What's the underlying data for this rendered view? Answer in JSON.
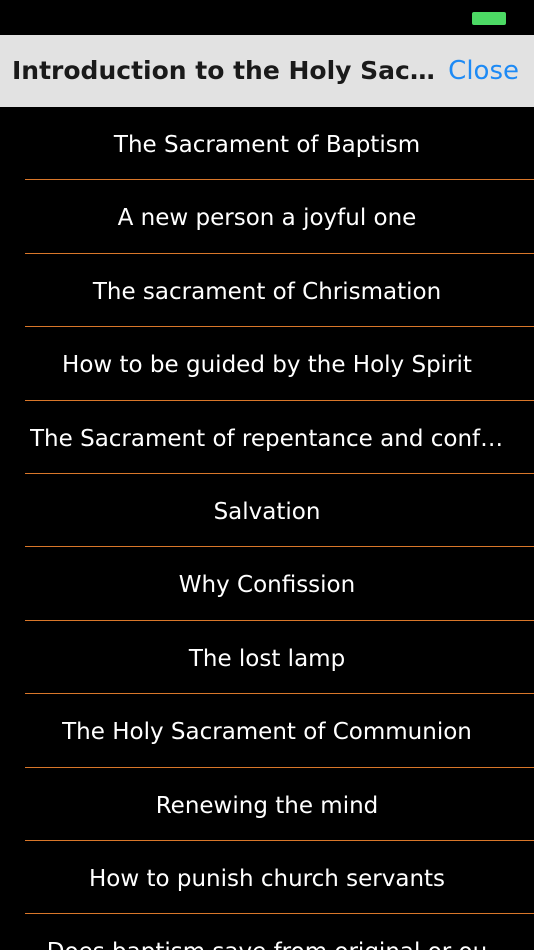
{
  "status_bar": {
    "battery_color": "#4cd964"
  },
  "nav": {
    "title": "Introduction to the Holy Sacraments",
    "close_label": "Close"
  },
  "items": [
    {
      "label": "The Sacrament of Baptism"
    },
    {
      "label": "A new person a joyful one"
    },
    {
      "label": "The sacrament of Chrismation"
    },
    {
      "label": "How to be guided by the Holy Spirit"
    },
    {
      "label": "The Sacrament of repentance and confession"
    },
    {
      "label": "Salvation"
    },
    {
      "label": "Why Confission"
    },
    {
      "label": "The lost lamp"
    },
    {
      "label": "The Holy Sacrament of Communion"
    },
    {
      "label": "Renewing the mind"
    },
    {
      "label": "How to punish church servants"
    },
    {
      "label": "Does baptism save from original or ou"
    }
  ],
  "colors": {
    "separator": "#d9772a",
    "accent": "#1d8af5",
    "nav_background": "#e2e2e2"
  }
}
